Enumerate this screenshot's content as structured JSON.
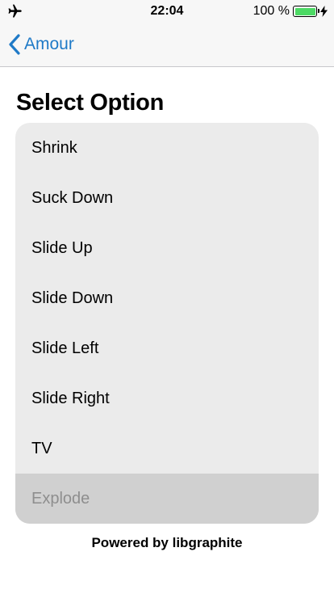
{
  "status_bar": {
    "left_icon": "airplane-icon",
    "time": "22:04",
    "battery_percent": "100 %",
    "battery_level": 1.0,
    "battery_color": "#4cd964",
    "charging_icon": "bolt-icon"
  },
  "nav": {
    "back_icon": "chevron-left-icon",
    "back_label": "Amour",
    "accent_color": "#1f7ac7"
  },
  "section": {
    "title": "Select Option"
  },
  "options": [
    {
      "label": "Shrink",
      "selected": false
    },
    {
      "label": "Suck Down",
      "selected": false
    },
    {
      "label": "Slide Up",
      "selected": false
    },
    {
      "label": "Slide Down",
      "selected": false
    },
    {
      "label": "Slide Left",
      "selected": false
    },
    {
      "label": "Slide Right",
      "selected": false
    },
    {
      "label": "TV",
      "selected": false
    },
    {
      "label": "Explode",
      "selected": true
    }
  ],
  "footer": {
    "text": "Powered by libgraphite"
  }
}
